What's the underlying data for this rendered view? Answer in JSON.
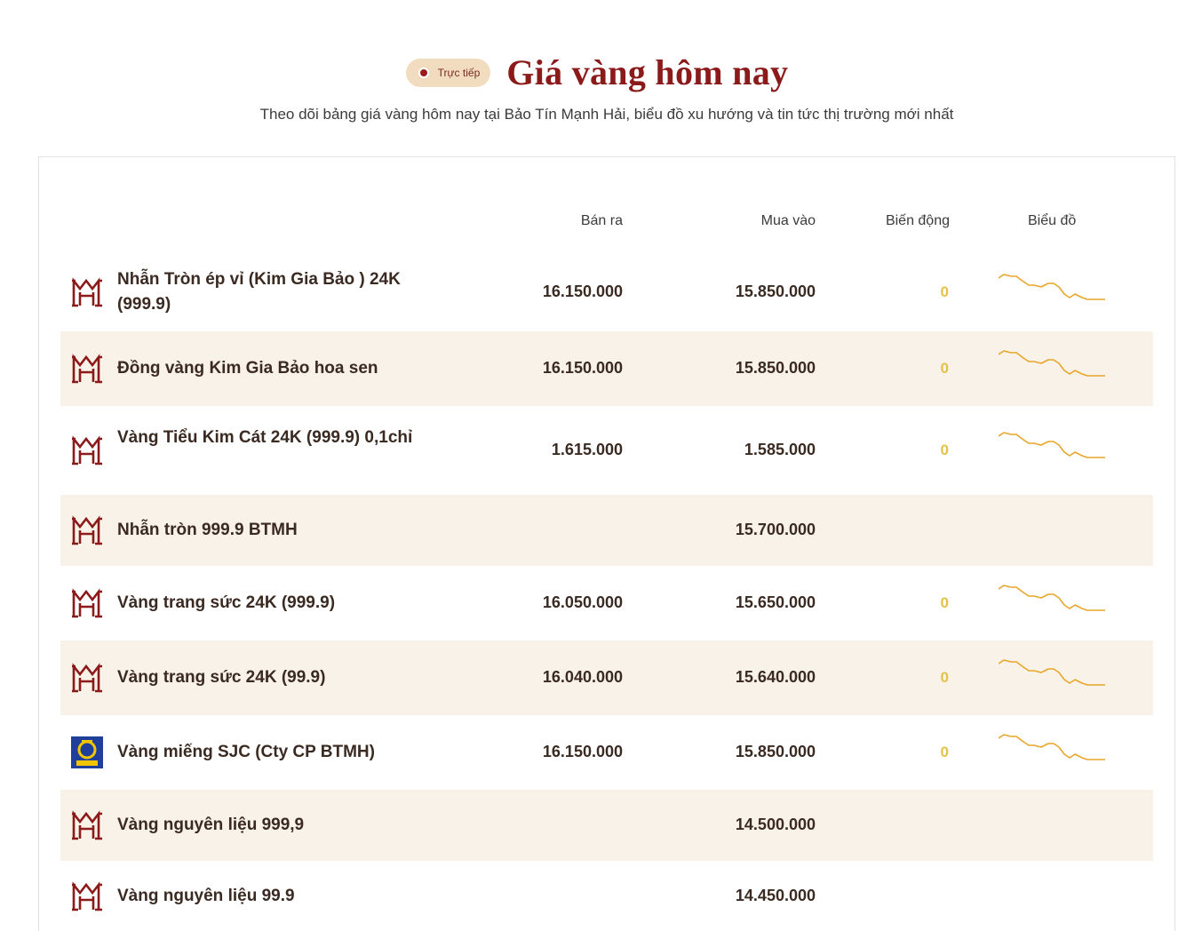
{
  "header": {
    "live_label": "Trực tiếp",
    "title": "Giá vàng hôm nay",
    "subtitle": "Theo dõi bảng giá vàng hôm nay tại Bảo Tín Mạnh Hải, biểu đồ xu hướng và tin tức thị trường mới nhất"
  },
  "table": {
    "columns": {
      "sell": "Bán ra",
      "buy": "Mua vào",
      "change": "Biến động",
      "chart": "Biểu đồ"
    },
    "rows": [
      {
        "name": "Nhẫn Tròn ép vỉ (Kim Gia Bảo ) 24K (999.9)",
        "sell": "16.150.000",
        "buy": "15.850.000",
        "change": "0",
        "logo": "btmh-logo-icon",
        "has_chart": true
      },
      {
        "name": "Đồng vàng Kim Gia Bảo hoa sen",
        "sell": "16.150.000",
        "buy": "15.850.000",
        "change": "0",
        "logo": "btmh-logo-icon",
        "has_chart": true
      },
      {
        "name": "Vàng Tiểu Kim Cát 24K (999.9) 0,1chỉ",
        "sell": "1.615.000",
        "buy": "1.585.000",
        "change": "0",
        "logo": "btmh-logo-icon",
        "has_chart": true
      },
      {
        "name": "Nhẫn tròn 999.9 BTMH",
        "sell": "",
        "buy": "15.700.000",
        "change": "",
        "logo": "btmh-logo-icon",
        "has_chart": false
      },
      {
        "name": "Vàng trang sức 24K (999.9)",
        "sell": "16.050.000",
        "buy": "15.650.000",
        "change": "0",
        "logo": "btmh-logo-icon",
        "has_chart": true
      },
      {
        "name": "Vàng trang sức 24K (99.9)",
        "sell": "16.040.000",
        "buy": "15.640.000",
        "change": "0",
        "logo": "btmh-logo-icon",
        "has_chart": true
      },
      {
        "name": "Vàng miếng SJC (Cty CP BTMH)",
        "sell": "16.150.000",
        "buy": "15.850.000",
        "change": "0",
        "logo": "sjc-logo-icon",
        "has_chart": true
      },
      {
        "name": "Vàng nguyên liệu 999,9",
        "sell": "",
        "buy": "14.500.000",
        "change": "",
        "logo": "btmh-logo-icon",
        "has_chart": false
      },
      {
        "name": "Vàng nguyên liệu 99.9",
        "sell": "",
        "buy": "14.450.000",
        "change": "",
        "logo": "btmh-logo-icon",
        "has_chart": false
      }
    ]
  },
  "colors": {
    "brand_red": "#8b1a1a",
    "badge_bg": "#f2dcc0",
    "row_alt": "#f9f2e8",
    "change_zero": "#e6c14a",
    "sparkline": "#e8a62a",
    "sjc_blue": "#1f3f9a",
    "sjc_yellow": "#f2c500"
  }
}
